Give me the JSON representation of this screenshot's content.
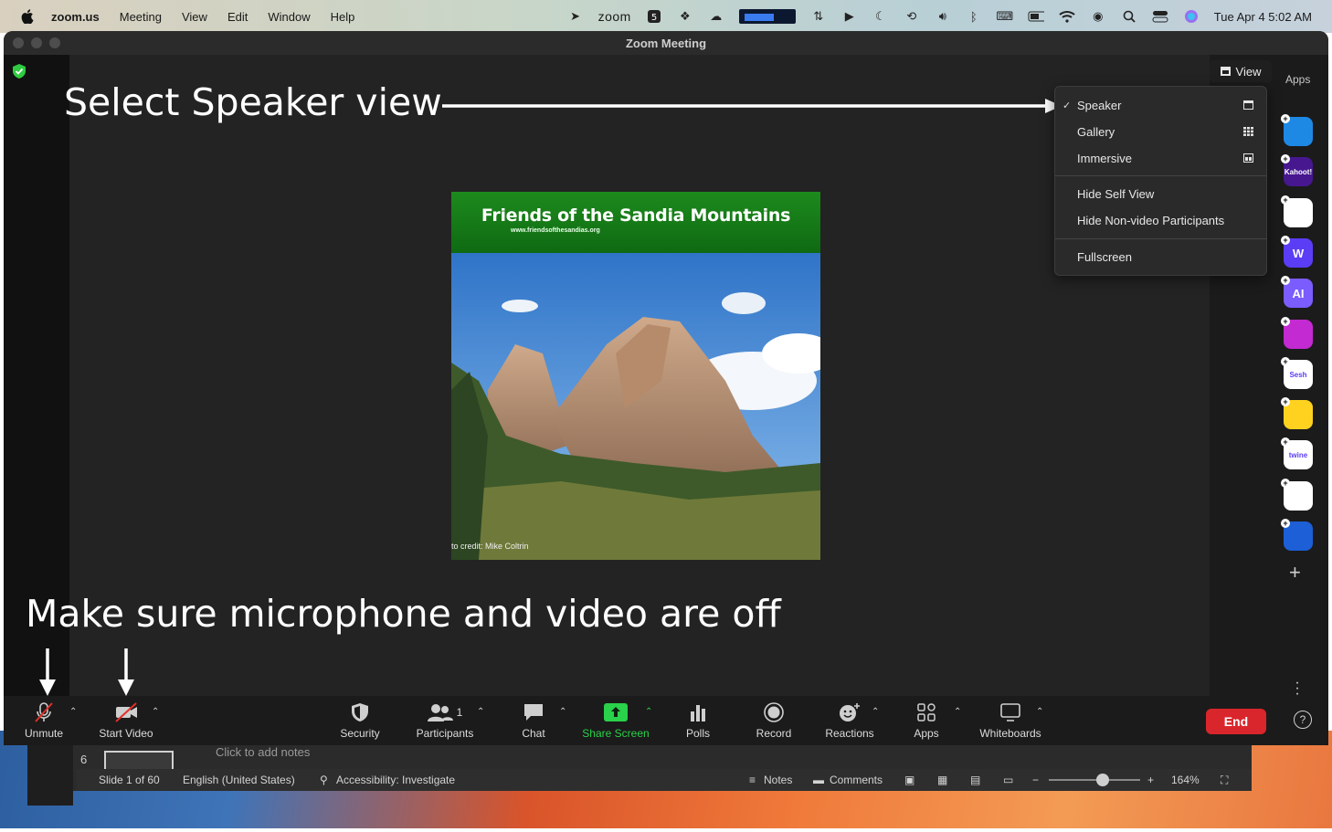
{
  "menubar": {
    "app_name": "zoom.us",
    "menus": [
      "Meeting",
      "View",
      "Edit",
      "Window",
      "Help"
    ],
    "zoom_label": "zoom",
    "clock": "Tue Apr 4  5:02 AM"
  },
  "window": {
    "title": "Zoom Meeting"
  },
  "annotations": {
    "top": "Select Speaker view",
    "bottom": "Make sure microphone and video are off"
  },
  "slide": {
    "title": "Friends of the Sandia Mountains",
    "url": "www.friendsofthesandias.org",
    "credit": "to credit: Mike Coltrin"
  },
  "view_button": {
    "label": "View"
  },
  "view_menu": {
    "items": [
      {
        "label": "Speaker",
        "checked": true,
        "icon": "speaker-layout-icon"
      },
      {
        "label": "Gallery",
        "checked": false,
        "icon": "gallery-grid-icon"
      },
      {
        "label": "Immersive",
        "checked": false,
        "icon": "immersive-icon"
      },
      {
        "label": "Hide Self View"
      },
      {
        "label": "Hide Non-video Participants"
      },
      {
        "label": "Fullscreen"
      }
    ]
  },
  "apps_sidebar": {
    "label": "Apps",
    "apps": [
      {
        "name": "app-arrow",
        "color": "#1e88e5",
        "text": ""
      },
      {
        "name": "kahoot",
        "color": "#46178f",
        "text": "Kahoot!"
      },
      {
        "name": "app-red",
        "color": "#ffffff",
        "text": ""
      },
      {
        "name": "app-w",
        "color": "#5b3df5",
        "text": "W"
      },
      {
        "name": "app-ai",
        "color": "#7b5cff",
        "text": "AI"
      },
      {
        "name": "app-wave",
        "color": "#c42ad1",
        "text": ""
      },
      {
        "name": "sesh",
        "color": "#ffffff",
        "text": "Sesh"
      },
      {
        "name": "app-emoji",
        "color": "#ffd21f",
        "text": ""
      },
      {
        "name": "twine",
        "color": "#ffffff",
        "text": "twine"
      },
      {
        "name": "app-blocks",
        "color": "#ffffff",
        "text": ""
      },
      {
        "name": "app-sync",
        "color": "#1c5fd6",
        "text": ""
      }
    ]
  },
  "toolbar": {
    "unmute": "Unmute",
    "start_video": "Start Video",
    "security": "Security",
    "participants": "Participants",
    "participant_count": "1",
    "chat": "Chat",
    "share_screen": "Share Screen",
    "polls": "Polls",
    "record": "Record",
    "reactions": "Reactions",
    "apps": "Apps",
    "whiteboards": "Whiteboards",
    "end": "End",
    "help": "?"
  },
  "powerpoint": {
    "slide_number": "6",
    "notes_placeholder": "Click to add notes",
    "status": {
      "slide": "Slide 1 of 60",
      "language": "English (United States)",
      "accessibility": "Accessibility: Investigate",
      "notes": "Notes",
      "comments": "Comments",
      "zoom_level": "164%"
    }
  },
  "colors": {
    "end_button": "#d9262c",
    "share_green": "#2ad14a",
    "slide_green": "#1d8a1d"
  }
}
